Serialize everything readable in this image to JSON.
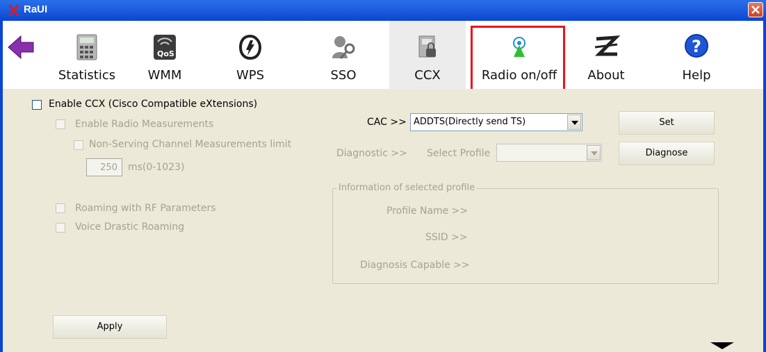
{
  "window": {
    "title": "RaUI",
    "colors": {
      "titlebar": "#0a46d2",
      "highlight": "#e8141b",
      "panel": "#ece9d8"
    }
  },
  "toolbar": {
    "items": [
      {
        "label": "Statistics",
        "icon": "calculator-icon"
      },
      {
        "label": "WMM",
        "icon": "qos-signal-icon"
      },
      {
        "label": "WPS",
        "icon": "wps-icon"
      },
      {
        "label": "SSO",
        "icon": "user-key-icon"
      },
      {
        "label": "CCX",
        "icon": "ccx-lock-icon",
        "active": true
      },
      {
        "label": "Radio on/off",
        "icon": "radio-antenna-icon",
        "highlighted": true
      },
      {
        "label": "About",
        "icon": "about-z-icon"
      },
      {
        "label": "Help",
        "icon": "help-icon"
      }
    ]
  },
  "left": {
    "enable_ccx": "Enable CCX (Cisco Compatible eXtensions)",
    "enable_radio": "Enable Radio Measurements",
    "non_serving": "Non-Serving Channel Measurements limit",
    "limit_value": "250",
    "limit_unit": "ms(0-1023)",
    "roaming_rf": "Roaming with RF Parameters",
    "voice_roaming": "Voice Drastic Roaming",
    "apply": "Apply"
  },
  "right": {
    "cac_label": "CAC >>",
    "cac_value": "ADDTS(Directly send TS)",
    "set": "Set",
    "diagnostic_label": "Diagnostic >>",
    "select_profile": "Select Profile",
    "diagnose": "Diagnose",
    "info_title": "Information of selected profile",
    "profile_name": "Profile Name >>",
    "ssid": "SSID >>",
    "diagnosis_capable": "Diagnosis Capable >>"
  }
}
